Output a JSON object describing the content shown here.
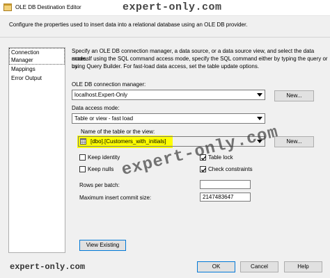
{
  "window": {
    "title": "OLE DB Destination Editor",
    "watermark": "expert-only.com"
  },
  "description": "Configure the properties used to insert data into a relational database using an OLE DB provider.",
  "nav": {
    "items": [
      "Connection Manager",
      "Mappings",
      "Error Output"
    ]
  },
  "main": {
    "intro_lines": [
      "Specify an OLE DB connection manager, a data source, or a data source view, and select the data access",
      "mode. If using the SQL command access mode, specify the SQL command either by typing the query or by",
      "using Query Builder. For fast-load data access, set the table update options."
    ],
    "connection_label": "OLE DB connection manager:",
    "connection_value": "localhost.Expert-Only",
    "new_label": "New...",
    "access_mode_label": "Data access mode:",
    "access_mode_value": "Table or view - fast load",
    "table_label": "Name of the table or the view:",
    "table_value": "[dbo].[Customers_with_initials]",
    "options": {
      "keep_identity": {
        "label": "Keep identity",
        "checked": false
      },
      "table_lock": {
        "label": "Table lock",
        "checked": true
      },
      "keep_nulls": {
        "label": "Keep nulls",
        "checked": false
      },
      "check_constraints": {
        "label": "Check constraints",
        "checked": true
      }
    },
    "rows_per_batch_label": "Rows per batch:",
    "rows_per_batch_value": "",
    "max_commit_label": "Maximum insert commit size:",
    "max_commit_value": "2147483647",
    "view_existing_label": "View Existing"
  },
  "footer": {
    "ok": "OK",
    "cancel": "Cancel",
    "help": "Help",
    "watermark": "expert-only.com"
  },
  "overlay_watermark": "expert-only.com",
  "colors": {
    "highlight": "#ffff00",
    "accent": "#0078d7"
  }
}
